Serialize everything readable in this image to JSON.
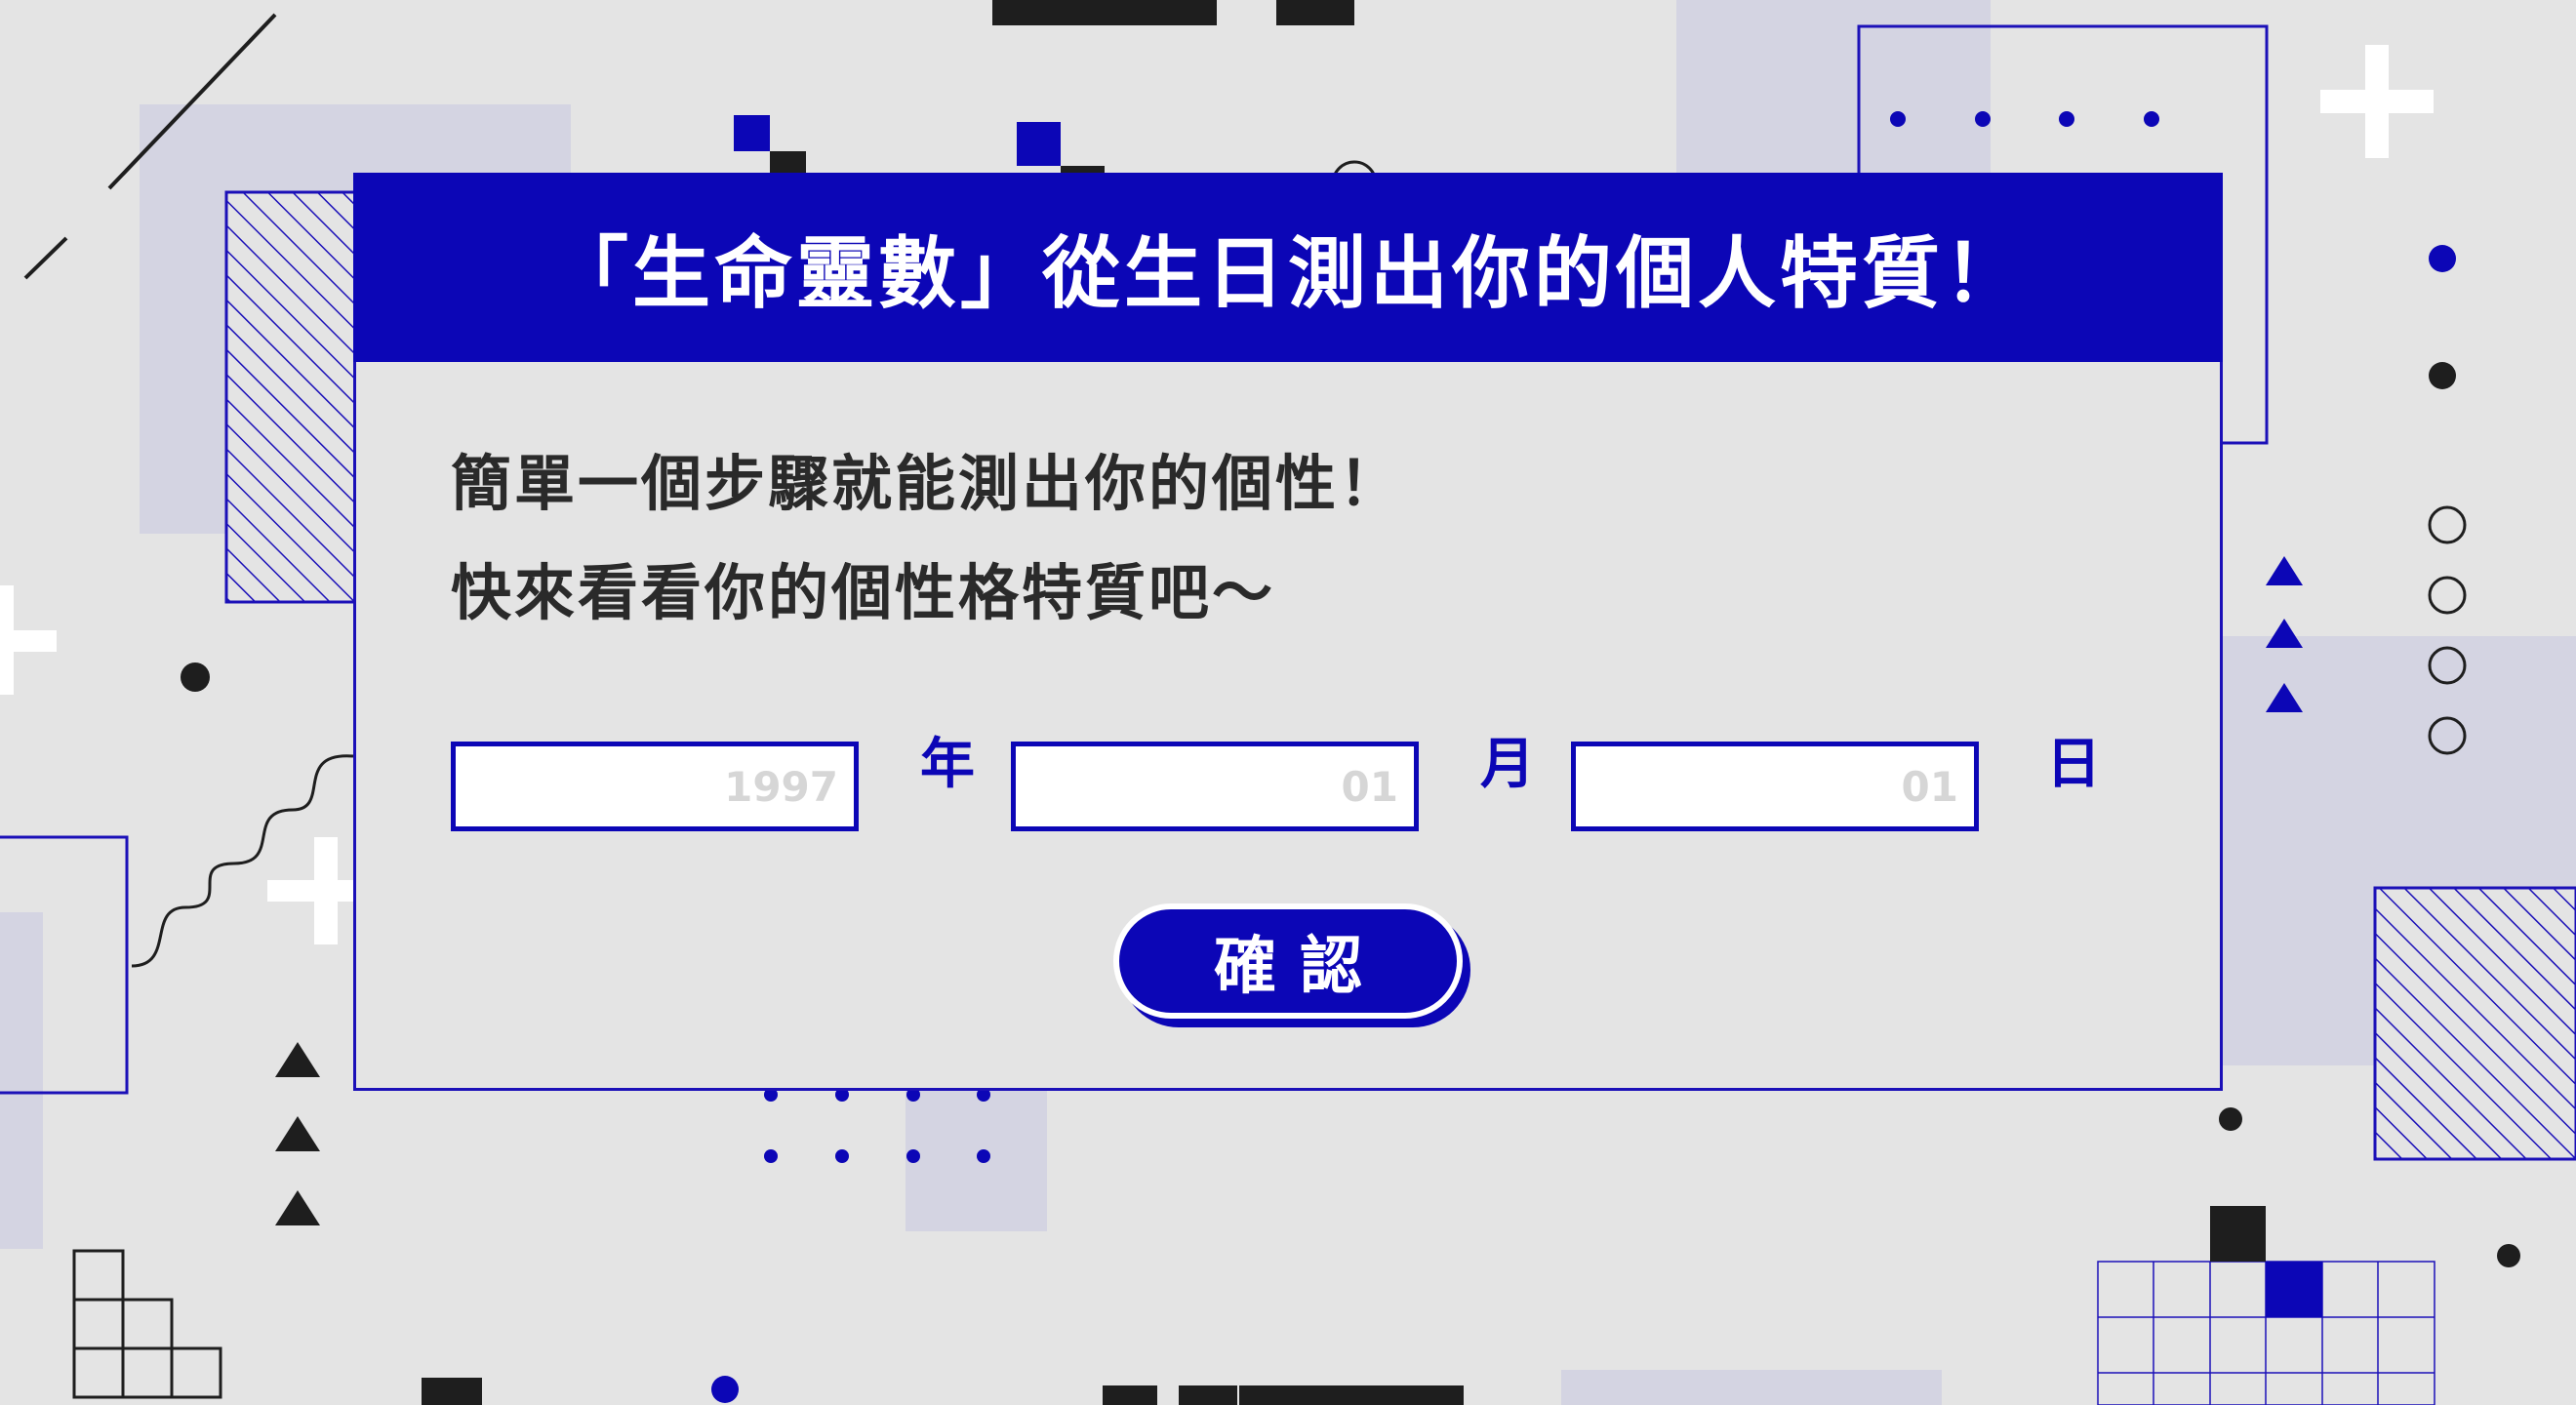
{
  "colors": {
    "background": "#e4e4e4",
    "primary": "#0c06b6",
    "lavender": "#d4d4e2",
    "dark": "#1e1e1e",
    "white": "#ffffff"
  },
  "header": {
    "title": "「生命靈數」從生日測出你的個人特質！"
  },
  "intro": {
    "line1": "簡單一個步驟就能測出你的個性！",
    "line2": "快來看看你的個性格特質吧～"
  },
  "form": {
    "year": {
      "placeholder": "1997",
      "unit": "年"
    },
    "month": {
      "placeholder": "01",
      "unit": "月"
    },
    "day": {
      "placeholder": "01",
      "unit": "日"
    },
    "confirm_label": "確認"
  },
  "decorations": {
    "icons": [
      "plus-icon",
      "triangle-icon",
      "circle-icon",
      "dot-icon",
      "hatched-square",
      "grid-pattern",
      "squiggle-line"
    ]
  }
}
